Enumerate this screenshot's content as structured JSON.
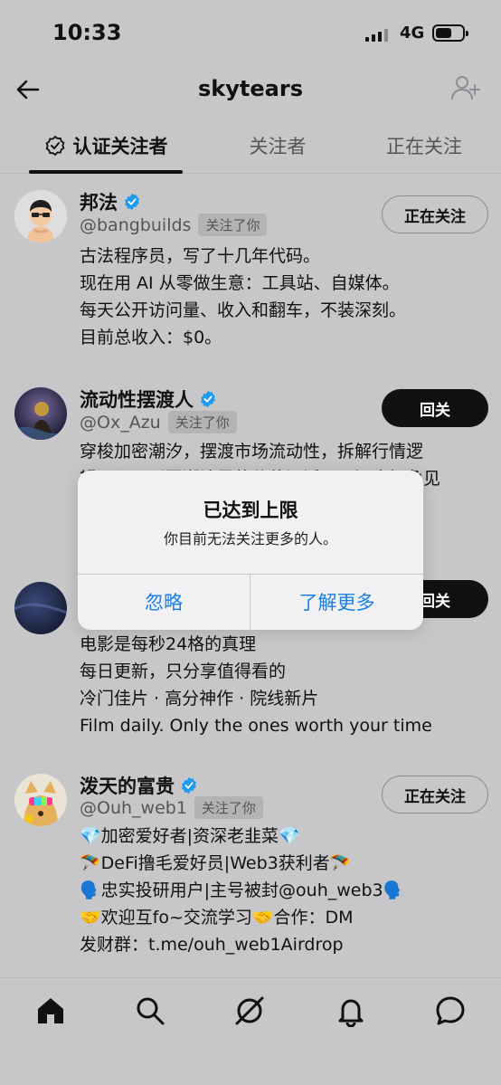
{
  "status": {
    "time": "10:33",
    "network": "4G"
  },
  "header": {
    "title": "skytears"
  },
  "tabs": [
    {
      "label": "认证关注者"
    },
    {
      "label": "关注者"
    },
    {
      "label": "正在关注"
    }
  ],
  "users": [
    {
      "name": "邦法",
      "handle": "@bangbuilds",
      "badge": "关注了你",
      "button": "正在关注",
      "bio": "古法程序员，写了十几年代码。\n现在用 AI 从零做生意：工具站、自媒体。\n每天公开访问量、收入和翻车，不装深刻。\n目前总收入：$0。"
    },
    {
      "name": "流动性摆渡人",
      "handle": "@Ox_Azu",
      "badge": "关注了你",
      "button": "回关",
      "bio": "穿梭加密潮汐，摆渡市场流动性，拆解行情逻\n辑，记录币圈潮汐里的价值沉浮，以深度视角见"
    },
    {
      "name": "",
      "handle": "",
      "badge": "",
      "button": "回关",
      "bio": "电影是每秒24格的真理\n每日更新，只分享值得看的\n冷门佳片 · 高分神作 · 院线新片\n Film daily. Only the ones worth your time"
    },
    {
      "name": "泼天的富贵",
      "handle": "@Ouh_web1",
      "badge": "关注了你",
      "button": "正在关注",
      "bio": "💎加密爱好者|资深老韭菜💎\n🪂DeFi撸毛爱好员|Web3获利者🪂\n🗣️忠实投研用户|主号被封@ouh_web3🗣️\n🤝欢迎互fo~交流学习🤝合作：DM\n发财群：t.me/ouh_web1Airdrop"
    }
  ],
  "dialog": {
    "title": "已达到上限",
    "message": "你目前无法关注更多的人。",
    "ignore": "忽略",
    "learn_more": "了解更多"
  },
  "nav": [
    "home-icon",
    "search-icon",
    "grok-icon",
    "bell-icon",
    "messages-icon"
  ],
  "colors": {
    "accent_blue": "#1a7ee8",
    "verified": "#1d9bf0",
    "background_dimmed": "#c7c7c9"
  }
}
